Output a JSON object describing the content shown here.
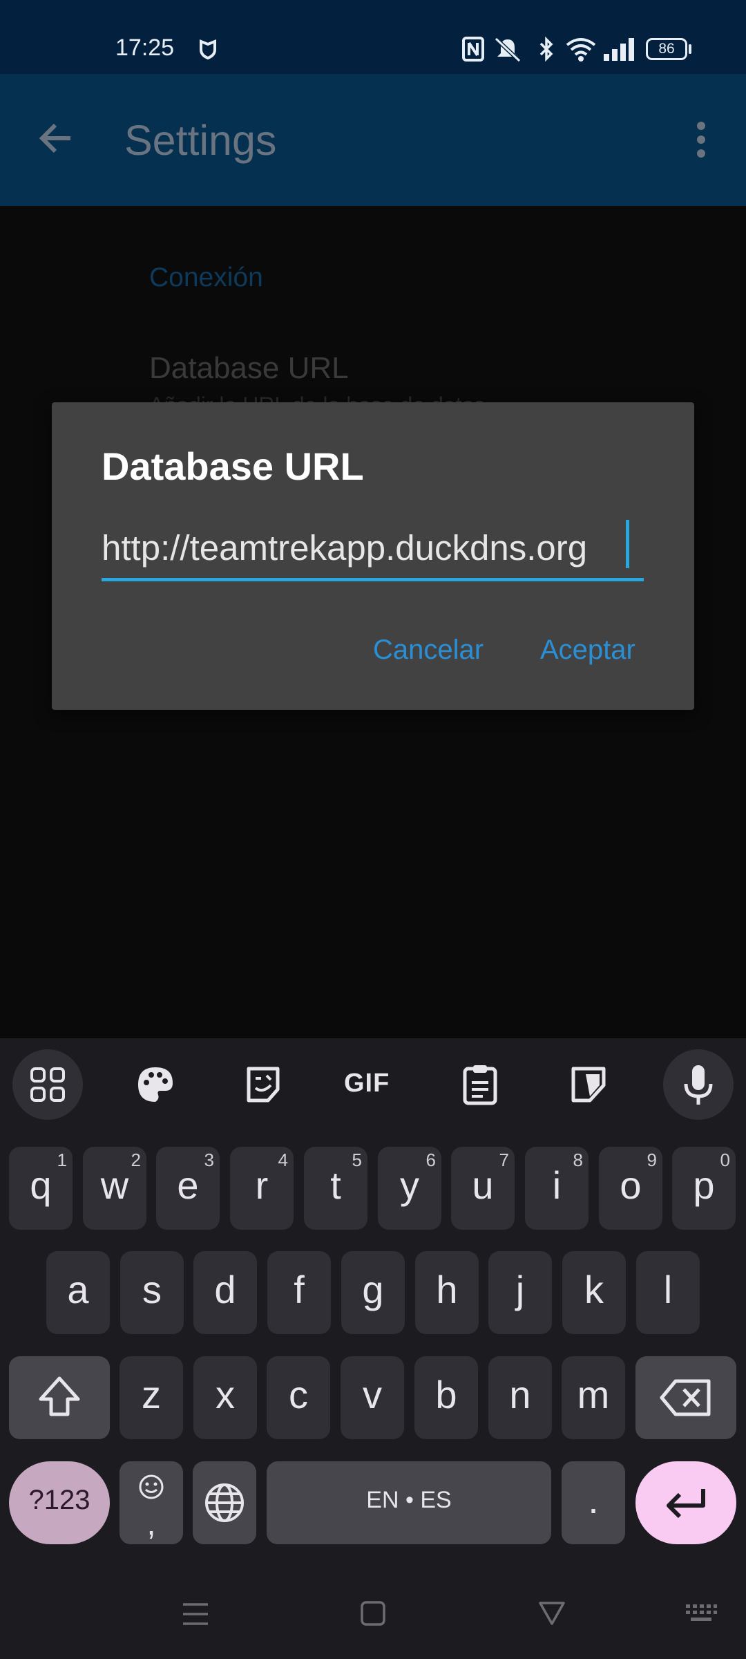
{
  "status_bar": {
    "time": "17:25",
    "battery": "86",
    "icons": [
      "shield-icon",
      "nfc-icon",
      "mute-vibrate-icon",
      "bluetooth-icon",
      "wifi-icon",
      "signal-icon",
      "battery-icon"
    ]
  },
  "app_bar": {
    "title": "Settings",
    "back_icon": "arrow-back-icon",
    "overflow_icon": "more-vert-icon"
  },
  "settings": {
    "section_title": "Conexión",
    "pref_title": "Database URL",
    "pref_summary": "Añadir la URL de la base de datos"
  },
  "dialog": {
    "title": "Database URL",
    "input_value": "http://teamtrekapp.duckdns.org",
    "cancel_label": "Cancelar",
    "accept_label": "Aceptar"
  },
  "keyboard": {
    "toolbar_icons": [
      "apps-grid-icon",
      "palette-icon",
      "sticker-icon",
      "gif-icon",
      "clipboard-icon",
      "screenshot-icon",
      "mic-icon"
    ],
    "gif_label": "GIF",
    "row1": [
      {
        "key": "q",
        "hint": "1"
      },
      {
        "key": "w",
        "hint": "2"
      },
      {
        "key": "e",
        "hint": "3"
      },
      {
        "key": "r",
        "hint": "4"
      },
      {
        "key": "t",
        "hint": "5"
      },
      {
        "key": "y",
        "hint": "6"
      },
      {
        "key": "u",
        "hint": "7"
      },
      {
        "key": "i",
        "hint": "8"
      },
      {
        "key": "o",
        "hint": "9"
      },
      {
        "key": "p",
        "hint": "0"
      }
    ],
    "row2": [
      "a",
      "s",
      "d",
      "f",
      "g",
      "h",
      "j",
      "k",
      "l"
    ],
    "row3": [
      "z",
      "x",
      "c",
      "v",
      "b",
      "n",
      "m"
    ],
    "symbols_label": "?123",
    "emoji_comma": ",",
    "space_label": "EN • ES",
    "period_label": "."
  },
  "nav_bar": {
    "icons": [
      "menu-icon",
      "home-icon",
      "back-triangle-icon",
      "keyboard-icon"
    ]
  }
}
